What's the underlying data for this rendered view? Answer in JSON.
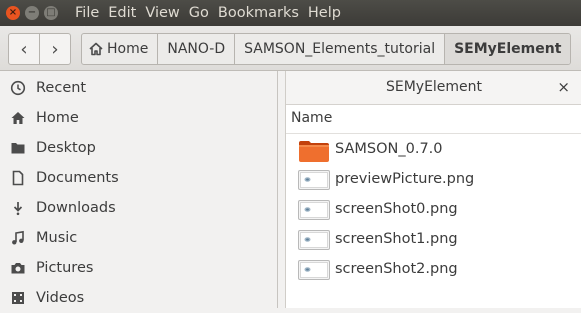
{
  "window": {
    "buttons": {
      "close": "×",
      "minimize": "−",
      "maximize": "□"
    },
    "menu": [
      "File",
      "Edit",
      "View",
      "Go",
      "Bookmarks",
      "Help"
    ]
  },
  "toolbar": {
    "back": "‹",
    "forward": "›",
    "path": [
      "Home",
      "NANO-D",
      "SAMSON_Elements_tutorial",
      "SEMyElement"
    ]
  },
  "sidebar": {
    "items": [
      {
        "label": "Recent",
        "icon": "clock-icon"
      },
      {
        "label": "Home",
        "icon": "home-icon"
      },
      {
        "label": "Desktop",
        "icon": "folder-icon"
      },
      {
        "label": "Documents",
        "icon": "document-icon"
      },
      {
        "label": "Downloads",
        "icon": "download-icon"
      },
      {
        "label": "Music",
        "icon": "music-icon"
      },
      {
        "label": "Pictures",
        "icon": "camera-icon"
      },
      {
        "label": "Videos",
        "icon": "video-icon"
      }
    ]
  },
  "tab": {
    "title": "SEMyElement",
    "close": "×"
  },
  "list": {
    "column_name": "Name",
    "files": [
      {
        "name": "SAMSON_0.7.0",
        "type": "folder"
      },
      {
        "name": "previewPicture.png",
        "type": "image"
      },
      {
        "name": "screenShot0.png",
        "type": "image"
      },
      {
        "name": "screenShot1.png",
        "type": "image"
      },
      {
        "name": "screenShot2.png",
        "type": "image"
      }
    ]
  },
  "colors": {
    "accent": "#e95420",
    "titlebar": "#3c3b37"
  }
}
